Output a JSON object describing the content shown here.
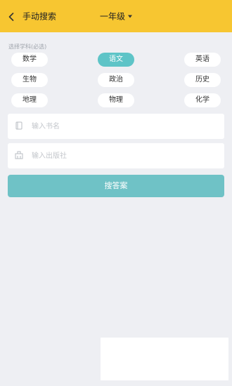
{
  "header": {
    "title": "手动搜索",
    "grade": "一年级",
    "background_color": "#f7c631"
  },
  "subjects": {
    "label": "选择学科(必选)",
    "selected": "语文",
    "accent_color": "#5ec4c7",
    "items": [
      "数学",
      "语文",
      "英语",
      "生物",
      "政治",
      "历史",
      "地理",
      "物理",
      "化学"
    ]
  },
  "fields": {
    "book_name": {
      "placeholder": "输入书名",
      "value": "",
      "icon": "book-icon"
    },
    "publisher": {
      "placeholder": "输入出版社",
      "value": "",
      "icon": "building-icon"
    }
  },
  "actions": {
    "search_label": "搜答案",
    "button_color": "#6fc2c6"
  },
  "icons": {
    "back": "back-arrow-icon",
    "grade_dropdown": "caret-down-icon"
  }
}
